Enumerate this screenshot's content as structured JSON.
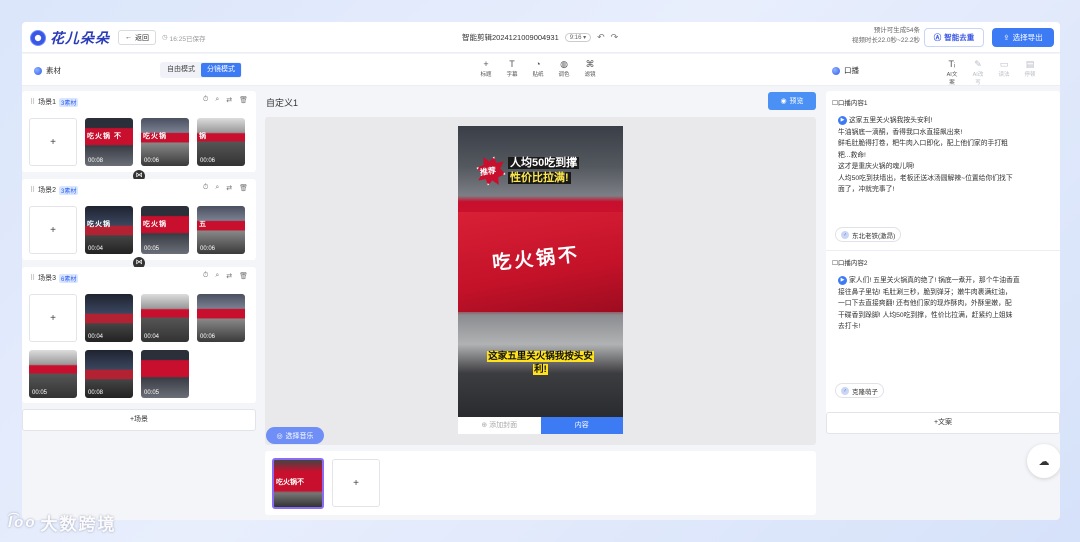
{
  "app": {
    "logo": "花儿朵朵",
    "back": "返回",
    "saved": "16:25已保存",
    "doc_title": "智能剪辑20241210090049​31",
    "ratio": "9:16 ▾"
  },
  "header": {
    "est_line1": "预计可生成54条",
    "est_line2": "视频时长22.0秒~22.2秒",
    "ai_button": "智能去重",
    "export_button": "选择导出"
  },
  "material": {
    "title": "素材",
    "mode_free": "自由模式",
    "mode_split": "分镜模式"
  },
  "tools": [
    {
      "icon": "+",
      "label": "标题"
    },
    {
      "icon": "T",
      "label": "字幕"
    },
    {
      "icon": "◔",
      "label": "贴纸"
    },
    {
      "icon": "◍",
      "label": "调色"
    },
    {
      "icon": "⌘",
      "label": "滤镜"
    }
  ],
  "oral": {
    "title": "口播"
  },
  "right_tools": [
    {
      "icon": "Tᵢ",
      "label": "AI文案",
      "disabled": false
    },
    {
      "icon": "✎",
      "label": "AI改写",
      "disabled": true
    },
    {
      "icon": "▭",
      "label": "读法",
      "disabled": true
    },
    {
      "icon": "▤",
      "label": "停顿",
      "disabled": true
    }
  ],
  "scenes": [
    {
      "name": "场景1",
      "count": "3素材",
      "clips": [
        {
          "dur": "00:08",
          "text": "吃火锅 不"
        },
        {
          "dur": "00:06",
          "text": "吃火锅"
        },
        {
          "dur": "00:06",
          "text": "锅"
        }
      ]
    },
    {
      "name": "场景2",
      "count": "3素材",
      "clips": [
        {
          "dur": "00:04",
          "text": "吃火锅"
        },
        {
          "dur": "00:05",
          "text": "吃火锅"
        },
        {
          "dur": "00:06",
          "text": "五"
        }
      ]
    },
    {
      "name": "场景3",
      "count": "6素材",
      "clips": [
        {
          "dur": "00:04",
          "text": ""
        },
        {
          "dur": "00:04",
          "text": ""
        },
        {
          "dur": "00:06",
          "text": ""
        },
        {
          "dur": "00:05",
          "text": ""
        },
        {
          "dur": "00:08",
          "text": ""
        },
        {
          "dur": "00:05",
          "text": ""
        }
      ]
    }
  ],
  "add_scene": "+场景",
  "editor": {
    "title": "自定义1",
    "preview": "预览",
    "burst": "推荐",
    "headline_1": "人均50吃到撑",
    "headline_2": "性价比拉满!",
    "sign": "吃火锅不",
    "caption_1": "这家五里关火锅我按头安",
    "caption_2": "利!",
    "tab_cover": "添加封面",
    "tab_content": "内容",
    "music": "选择音乐"
  },
  "scripts": [
    {
      "label": "口播内容1",
      "lines": [
        "这家五里关火锅我按头安利!",
        "牛油锅底一滴酮，香得我口水直接飙出来!",
        "鲜毛肚脆得打卷，粑牛肉入口即化，配上他们家的手打粗",
        "粑...救命!",
        "这才是重庆火锅的魂儿啊!",
        "人均50吃到扶墙出，老板还送冰汤圆解辣~位置给你们找下",
        "面了，冲就完事了!"
      ],
      "voice": "东北老铁(激昂)"
    },
    {
      "label": "口播内容2",
      "lines": [
        "家人们! 五里关火锅真的绝了! 锅底一煮开，那个牛油香直",
        "接往鼻子里钻! 毛肚涮三秒，脆到弹牙；嫩牛肉裹满红油，",
        "一口下去直接爽翻! 还有他们家的现炸酥肉，外酥里嫩，配",
        "干碟香到跺脚! 人均50吃到撑，性价比拉满，赶紧约上姐妹",
        "去打卡!"
      ],
      "voice": "克隆萌子"
    }
  ],
  "add_copy": "+文案",
  "watermark": "大数跨境",
  "watermark_logo": "l͡oo"
}
